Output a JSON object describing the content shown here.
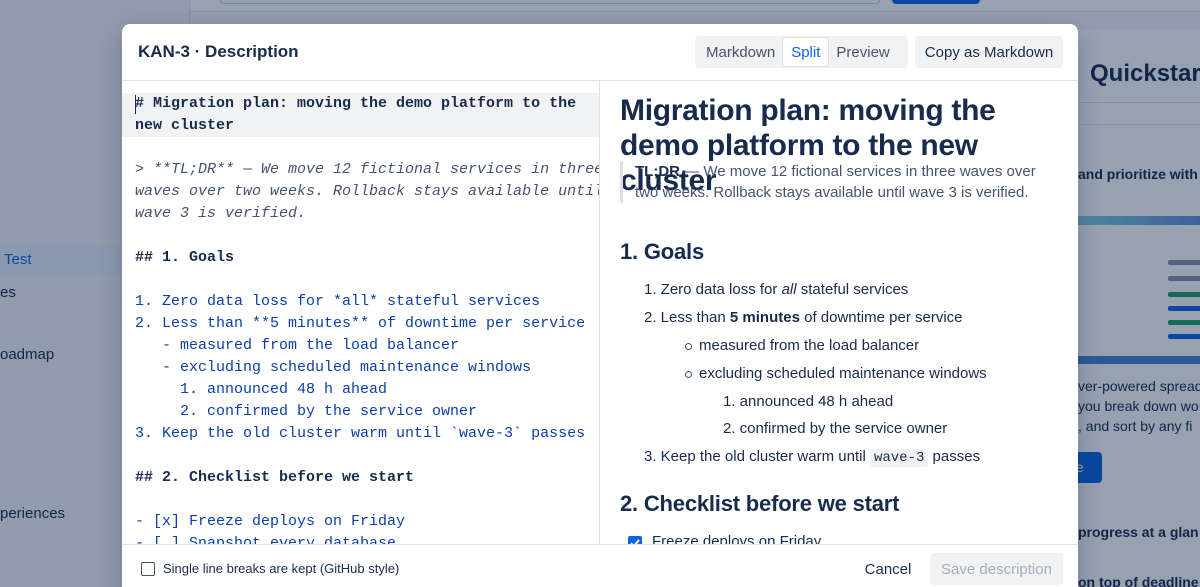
{
  "background": {
    "nav_items": [
      "Test",
      "es",
      "oadmap",
      "periences"
    ],
    "quickstart_title": "Quickstar",
    "card_text": {
      "prioritize": "and prioritize with",
      "spread1": "ver-powered spread",
      "spread2": "you break down wo",
      "spread3": ", and sort by any fi",
      "button": "e",
      "progress": "progress at a glan",
      "deadlines": "on top of deadline"
    }
  },
  "modal": {
    "title": "KAN-3 · Description",
    "view_modes": [
      "Markdown",
      "Split",
      "Preview"
    ],
    "active_view_mode": "Split",
    "copy_button": "Copy as Markdown"
  },
  "editor": {
    "lines": [
      "# Migration plan: moving the demo platform to the",
      "new cluster",
      "",
      "> **TL;DR** — We move 12 fictional services in three",
      "waves over two weeks. Rollback stays available until",
      "wave 3 is verified.",
      "",
      "## 1. Goals",
      "",
      "1. Zero data loss for *all* stateful services",
      "2. Less than **5 minutes** of downtime per service",
      "   - measured from the load balancer",
      "   - excluding scheduled maintenance windows",
      "     1. announced 48 h ahead",
      "     2. confirmed by the service owner",
      "3. Keep the old cluster warm until `wave-3` passes",
      "",
      "## 2. Checklist before we start",
      "",
      "- [x] Freeze deploys on Friday",
      "- [ ] Snapshot every database"
    ]
  },
  "preview": {
    "h1": "Migration plan: moving the demo platform to the new cluster",
    "quote_bold": "TL;DR",
    "quote_text": " — We move 12 fictional services in three waves over two weeks. Rollback stays available until wave 3 is verified.",
    "goals_heading": "1. Goals",
    "goal1_pre": "1. Zero data loss for ",
    "goal1_em": "all",
    "goal1_post": " stateful services",
    "goal2_pre": "2. Less than ",
    "goal2_bold": "5 minutes",
    "goal2_post": " of downtime per service",
    "sub1": "measured from the load balancer",
    "sub2": "excluding scheduled maintenance windows",
    "subsub1": "1. announced 48 h ahead",
    "subsub2": "2. confirmed by the service owner",
    "goal3_pre": "3. Keep the old cluster warm until ",
    "goal3_code": "wave-3",
    "goal3_post": " passes",
    "checklist_heading": "2. Checklist before we start",
    "check1": "Freeze deploys on Friday",
    "check1_checked": true
  },
  "footer": {
    "line_breaks_label": "Single line breaks are kept (GitHub style)",
    "line_breaks_checked": false,
    "cancel": "Cancel",
    "save": "Save description"
  },
  "colors": {
    "accent": "#0c66e4",
    "text": "#172b4d",
    "editor_list_text": "#0c3fa8"
  }
}
